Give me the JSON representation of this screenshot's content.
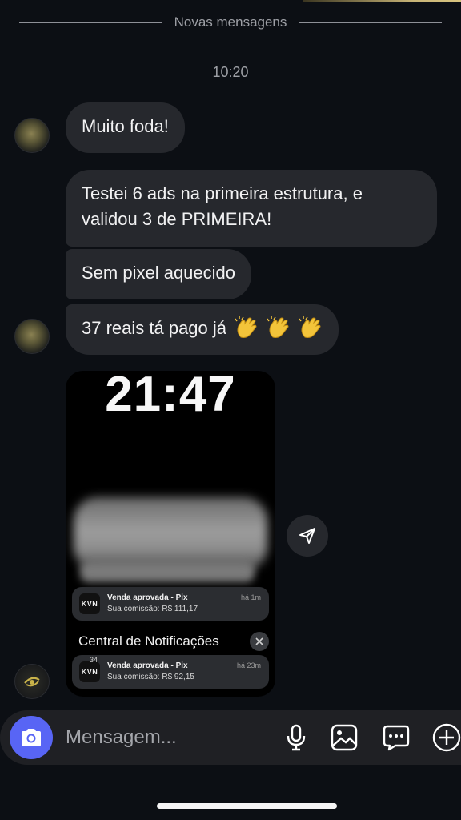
{
  "divider": {
    "label": "Novas mensagens"
  },
  "chat": {
    "time": "10:20",
    "messages": [
      {
        "text": "Muito foda!"
      },
      {
        "text": "Testei 6 ads na primeira estrutura, e validou 3 de PRIMEIRA!"
      },
      {
        "text": "Sem pixel aquecido"
      },
      {
        "text": "37 reais tá pago já",
        "emoji": "clapping-hands x3"
      }
    ],
    "attachment": {
      "clock": "21:47",
      "notifications": [
        {
          "app": "KVN",
          "title": "Venda aprovada - Pix",
          "subtitle": "Sua comissão: R$ 111,17",
          "time": "há 1m"
        },
        {
          "app": "KVN",
          "badge": "34",
          "title": "Venda aprovada - Pix",
          "subtitle": "Sua comissão: R$ 92,15",
          "time": "há 23m"
        }
      ],
      "center_title": "Central de Notificações"
    }
  },
  "composer": {
    "placeholder": "Mensagem...",
    "tools": [
      "microphone-icon",
      "gallery-icon",
      "sticker-icon",
      "plus-icon"
    ]
  },
  "colors": {
    "background": "#0c0f14",
    "bubble": "#26282d",
    "accent": "#5865f5"
  }
}
